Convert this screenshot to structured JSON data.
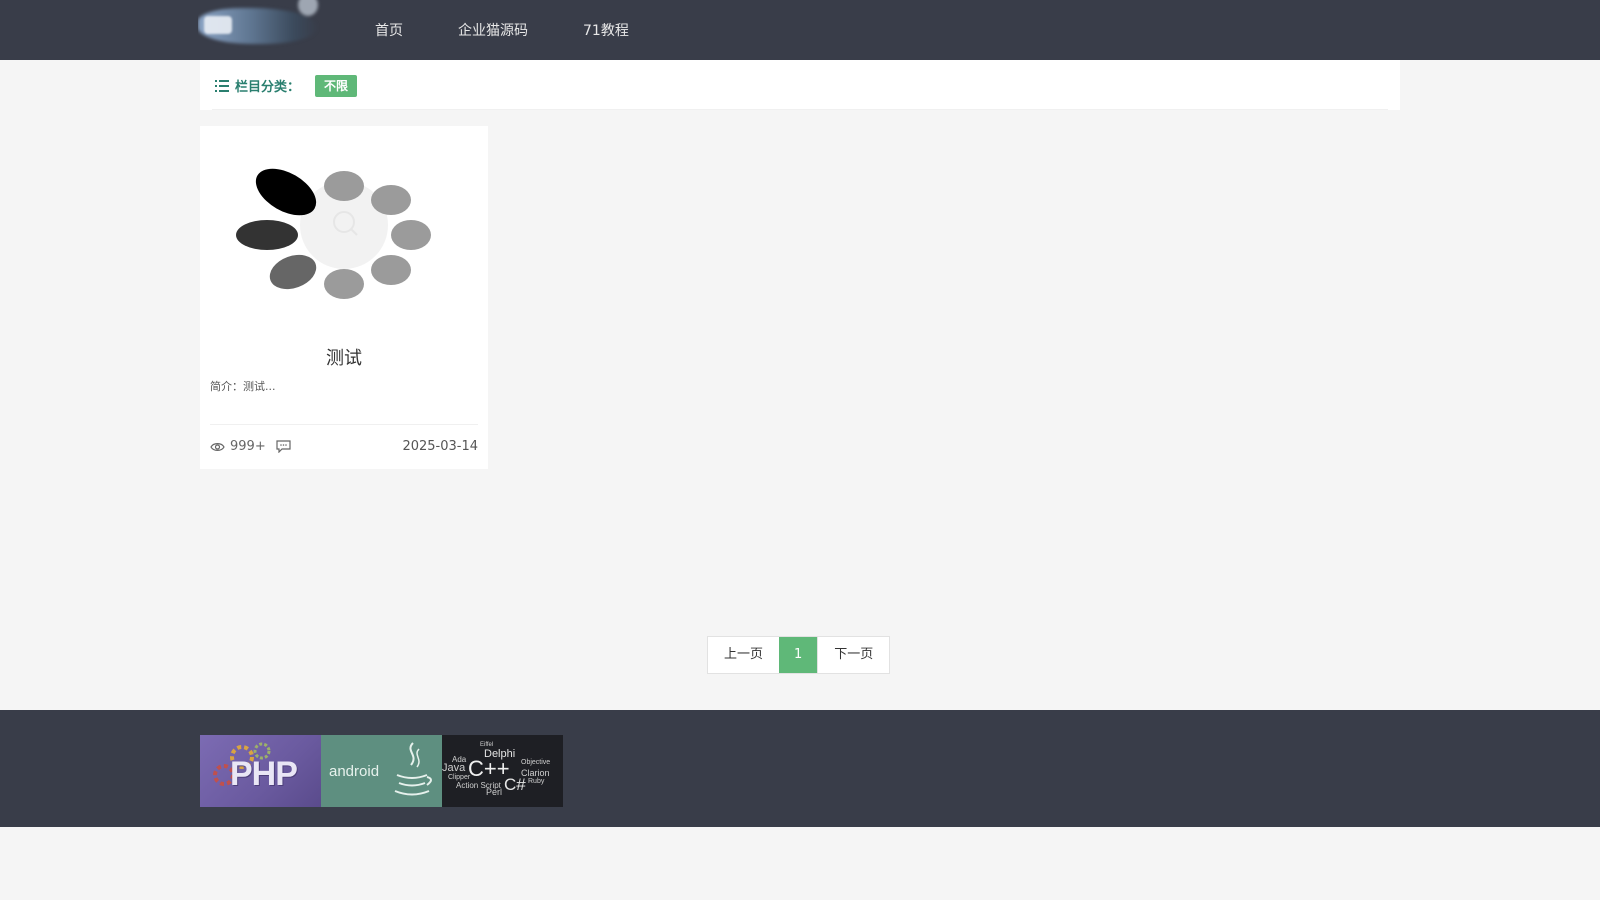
{
  "header": {
    "nav": [
      "首页",
      "企业猫源码",
      "71教程"
    ]
  },
  "category": {
    "label": "栏目分类：",
    "active_tag": "不限"
  },
  "card": {
    "title": "测试",
    "desc": "简介：测试...",
    "views": "999+",
    "date": "2025-03-14"
  },
  "pagination": {
    "prev": "上一页",
    "current": "1",
    "next": "下一页"
  },
  "footer": {
    "banners": {
      "php": "PHP",
      "android": "android",
      "cpp_words": [
        "Delphi",
        "C++",
        "Java",
        "Ada",
        "Objective",
        "Clarion",
        "Action Script",
        "Perl",
        "C#",
        "Ruby",
        "Clipper",
        "Eiffel"
      ]
    }
  },
  "colors": {
    "header_bg": "#393d49",
    "accent_green": "#5fb878",
    "category_text": "#2a7f6f",
    "page_bg": "#f5f5f5"
  }
}
